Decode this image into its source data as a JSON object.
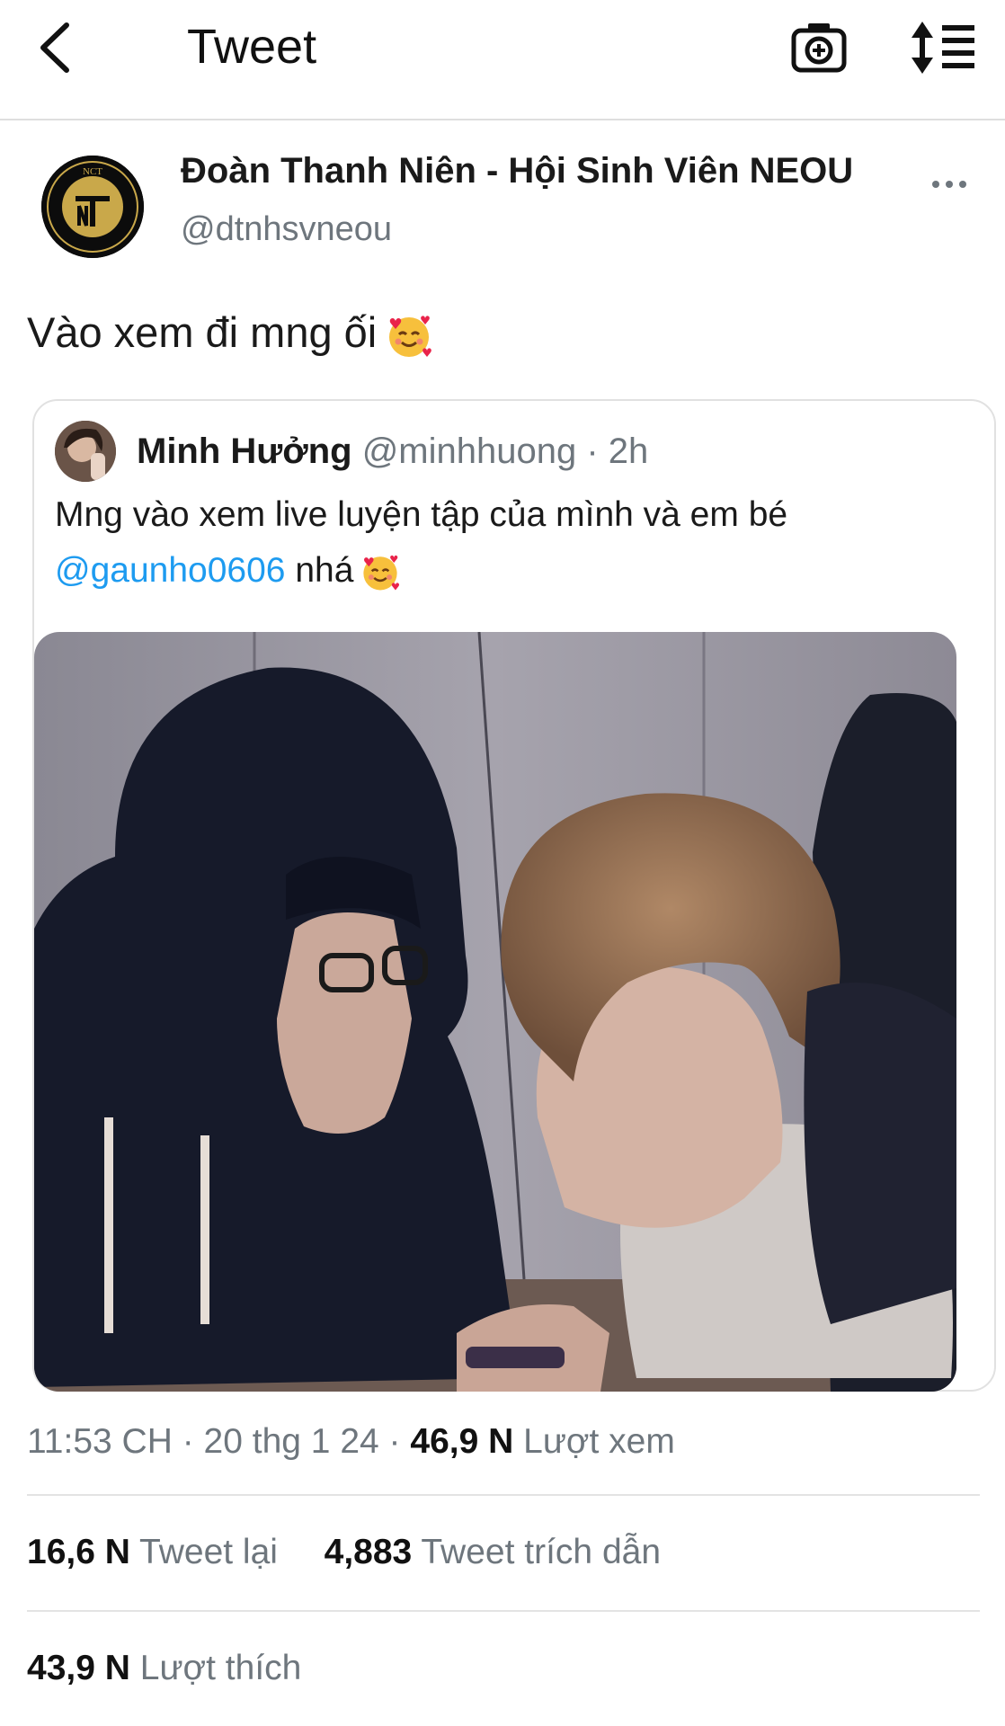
{
  "header": {
    "title": "Tweet",
    "back_icon": "chevron-left-icon",
    "camera_icon": "camera-plus-icon",
    "sort_icon": "sort-list-icon"
  },
  "tweet": {
    "author_name": "Đoàn Thanh Niên - Hội Sinh Viên NEOU",
    "author_handle": "@dtnhsvneou",
    "avatar_text": "NCT",
    "text": "Vào xem đi mng ối",
    "emoji": "smiling-face-with-hearts"
  },
  "quote": {
    "name": "Minh Hưởng",
    "handle": "@minhhuong",
    "time": "· 2h",
    "line1": "Mng vào xem live luyện tập của mình và em bé",
    "mention": "@gaunho0606",
    "line2_rest": " nhá"
  },
  "meta": {
    "time": "11:53 CH · 20 thg 1 24 ·",
    "views_count": "46,9 N",
    "views_label": "Lượt xem"
  },
  "stats": {
    "retweets_count": "16,6 N",
    "retweets_label": "Tweet lại",
    "quotes_count": "4,883",
    "quotes_label": "Tweet trích dẫn",
    "likes_count": "43,9 N",
    "likes_label": "Lượt thích"
  },
  "colors": {
    "link": "#1d9bf0",
    "muted": "#6e767d",
    "text": "#0f1419",
    "divider": "#e3e3e3"
  }
}
